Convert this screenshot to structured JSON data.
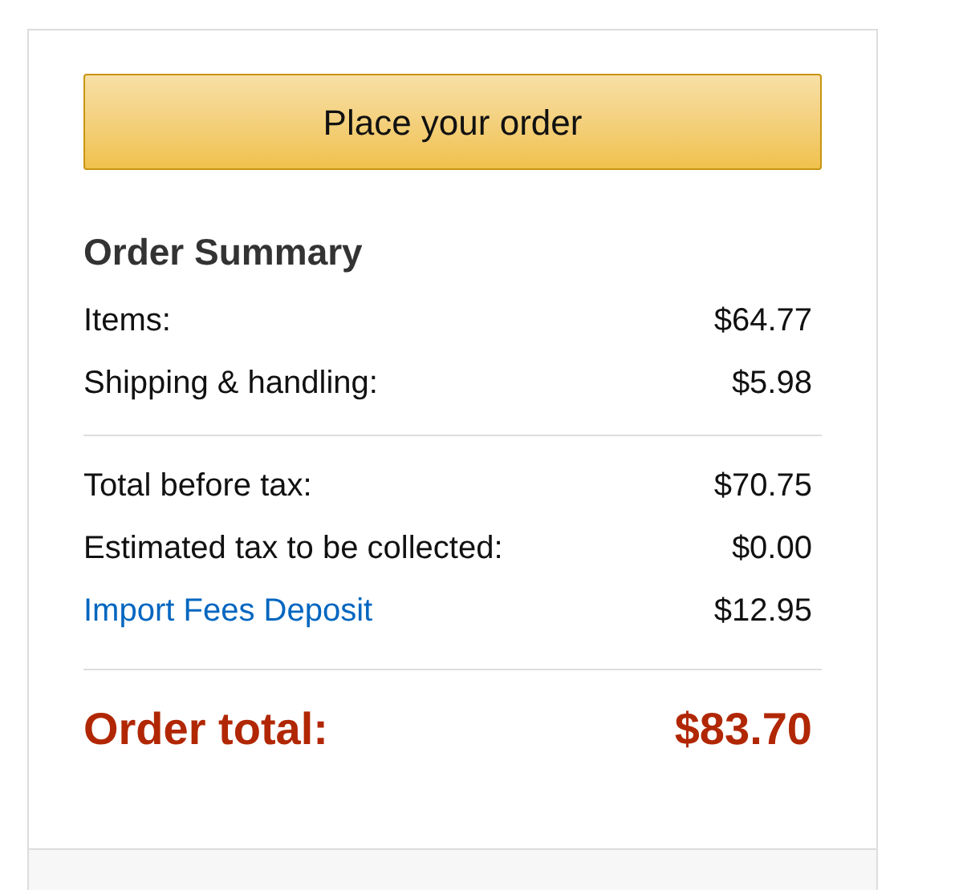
{
  "button": {
    "label": "Place your order"
  },
  "summary": {
    "title": "Order Summary",
    "groups": [
      {
        "rows": [
          {
            "kind": "text",
            "label": "Items:",
            "value": "$64.77"
          },
          {
            "kind": "text",
            "label": "Shipping & handling:",
            "value": "$5.98"
          }
        ]
      },
      {
        "rows": [
          {
            "kind": "text",
            "label": "Total before tax:",
            "value": "$70.75"
          },
          {
            "kind": "text",
            "label": "Estimated tax to be collected:",
            "value": "$0.00"
          },
          {
            "kind": "link",
            "label": "Import Fees Deposit",
            "value": "$12.95"
          }
        ]
      }
    ]
  },
  "total": {
    "label": "Order total:",
    "value": "$83.70"
  }
}
